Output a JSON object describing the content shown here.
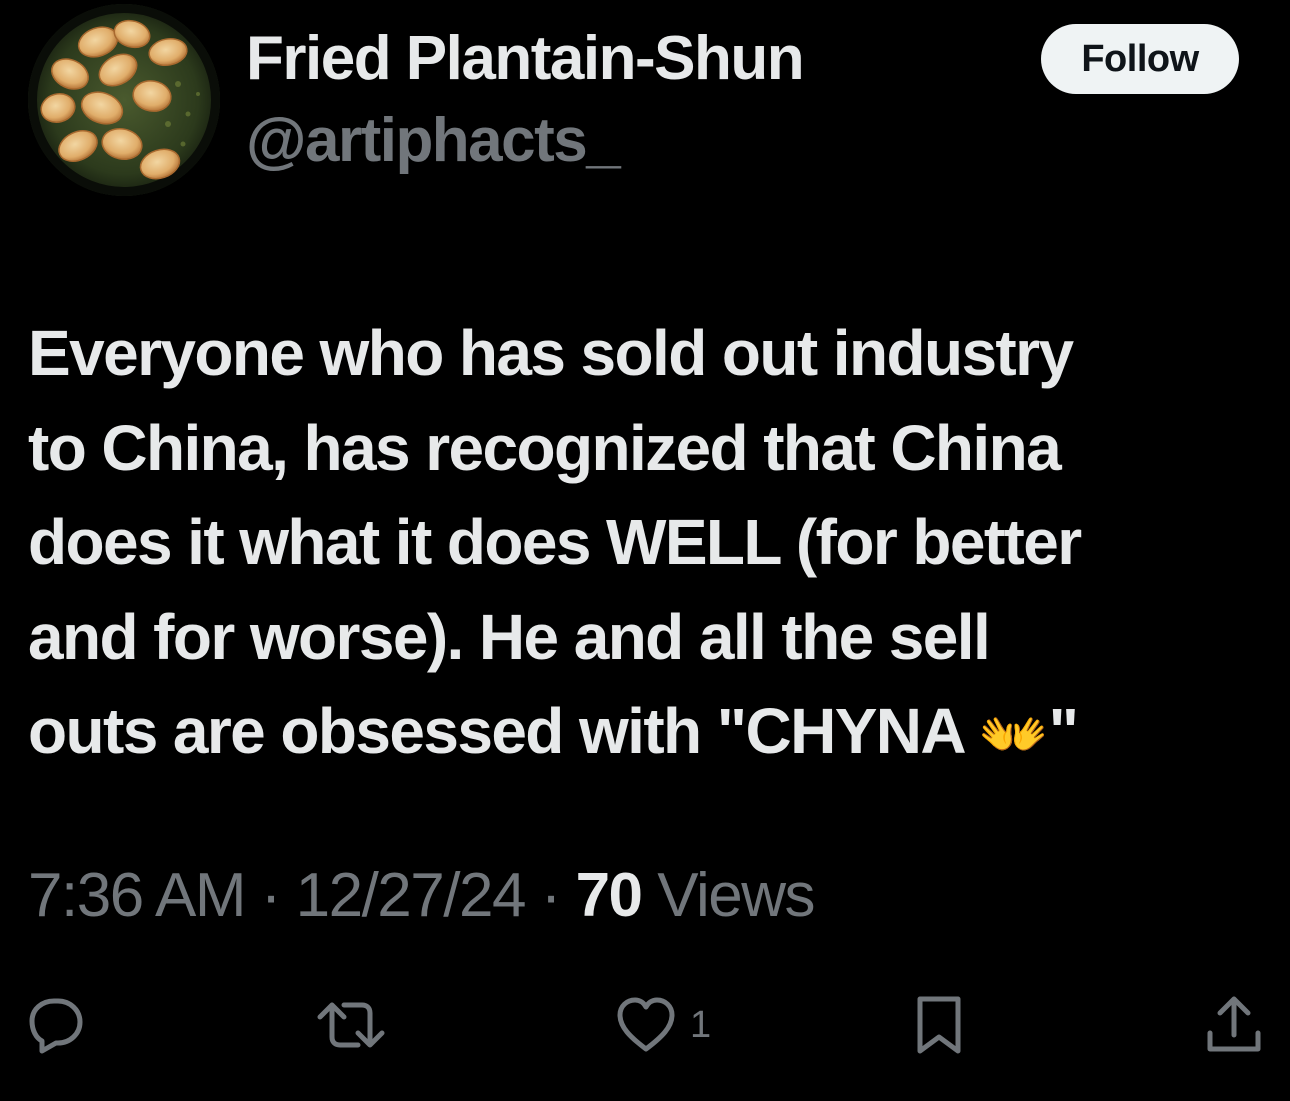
{
  "author": {
    "display_name": "Fried Plantain-Shun",
    "handle": "@artiphacts_",
    "avatar_icon": "fried-plantains-avatar"
  },
  "follow_button": {
    "label": "Follow"
  },
  "tweet": {
    "lines": [
      "Everyone who has sold out industry",
      "to China, has recognized that China",
      "does it what it does WELL (for better",
      "and for worse). He and all the sell",
      "outs are obsessed with \"CHYNA "
    ],
    "emoji": "👐",
    "trailing_quote": "\""
  },
  "meta": {
    "time": "7:36 AM",
    "separator": "·",
    "date": "12/27/24",
    "views_count": "70",
    "views_label": "Views"
  },
  "actions": {
    "reply_icon": "reply-icon",
    "retweet_icon": "retweet-icon",
    "like_icon": "heart-icon",
    "like_count": "1",
    "bookmark_icon": "bookmark-icon",
    "share_icon": "share-icon"
  },
  "colors": {
    "background": "#000000",
    "primary_text": "#e7e9ea",
    "secondary_text": "#71767b",
    "follow_bg": "#eff3f4",
    "follow_text": "#0f1419"
  }
}
